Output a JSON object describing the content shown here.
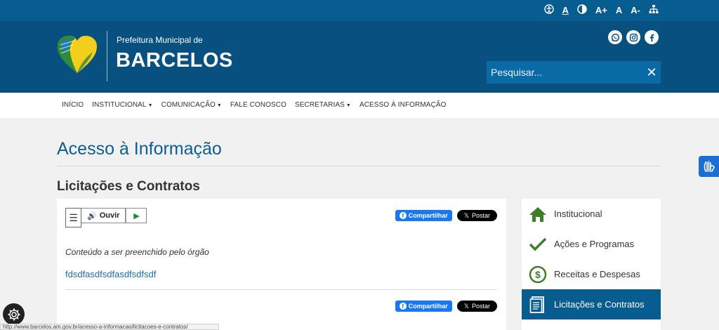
{
  "topbar": {
    "accessibility": {
      "contrast_icon": "contrast-icon",
      "font_normal": "A",
      "font_increase": "A+",
      "font_base": "A",
      "font_decrease": "A-"
    }
  },
  "header": {
    "subtitle": "Prefeitura Municipal de",
    "title": "BARCELOS",
    "search_placeholder": "Pesquisar...",
    "search_close": "✕"
  },
  "nav": {
    "items": [
      {
        "label": "INÍCIO",
        "dropdown": false
      },
      {
        "label": "INSTITUCIONAL",
        "dropdown": true
      },
      {
        "label": "COMUNICAÇÃO",
        "dropdown": true
      },
      {
        "label": "FALE CONOSCO",
        "dropdown": false
      },
      {
        "label": "SECRETARIAS",
        "dropdown": true
      },
      {
        "label": "ACESSO À INFORMAÇÃO",
        "dropdown": false
      }
    ]
  },
  "main": {
    "page_title": "Acesso à Informação",
    "section_title": "Licitações e Contratos",
    "listen_label": "Ouvir",
    "share_label": "Compartilhar",
    "post_label": "Postar",
    "placeholder_text": "Conteúdo a ser preenchido pelo órgão",
    "link_text": "fdsdfasdfsdfasdfsdfsdf"
  },
  "sidebar": {
    "items": [
      {
        "label": "Institucional",
        "icon": "home-icon",
        "active": false
      },
      {
        "label": "Ações e Programas",
        "icon": "checkmark-icon",
        "active": false
      },
      {
        "label": "Receitas e Despesas",
        "icon": "dollar-circle-icon",
        "active": false
      },
      {
        "label": "Licitações e Contratos",
        "icon": "document-icon",
        "active": true
      }
    ]
  },
  "statusbar": {
    "url": "http://www.barcelos.am.gov.br/acesso-a-informacao/licitacoes-e-contratos/"
  },
  "colors": {
    "topbar": "#075d8f",
    "header": "#075080",
    "accent": "#0a5e94",
    "active": "#075d8f",
    "green": "#3f7d2c"
  }
}
